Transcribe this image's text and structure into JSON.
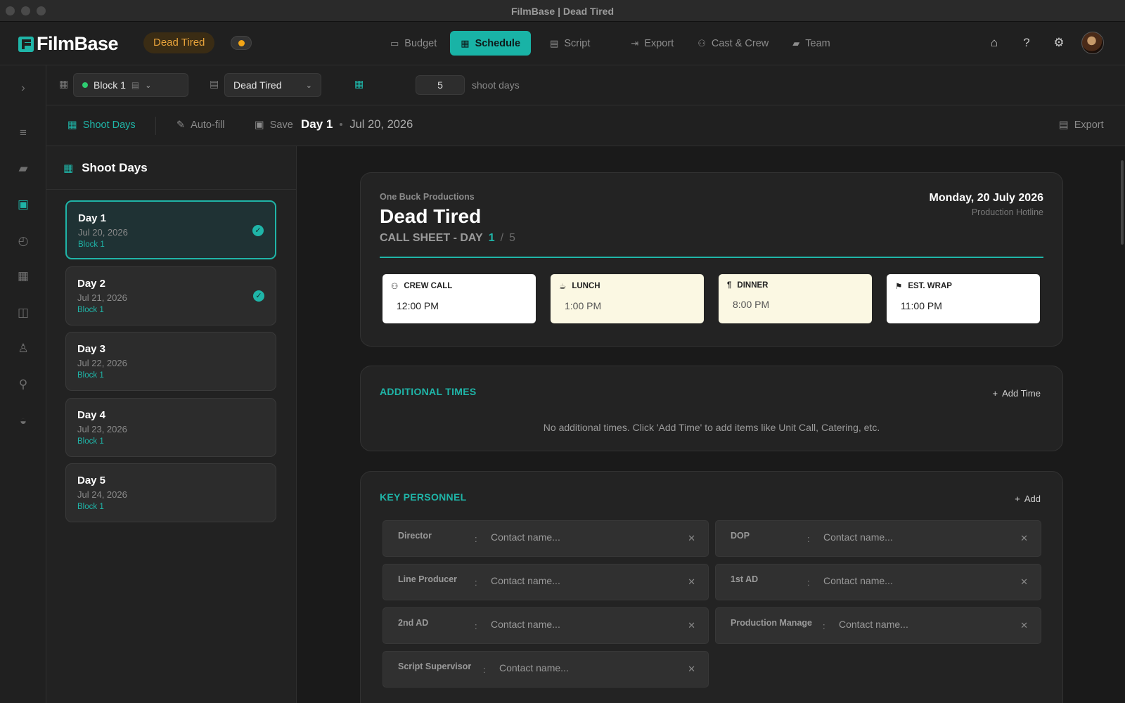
{
  "window": {
    "title": "FilmBase | Dead Tired"
  },
  "app": {
    "logo_text": "FilmBase",
    "project_pill": "Dead Tired",
    "status_color": "#f2a516"
  },
  "nav": {
    "tabs": [
      {
        "label": "Budget",
        "icon": "budget-icon"
      },
      {
        "label": "Schedule",
        "icon": "calendar-icon",
        "active": true
      },
      {
        "label": "Script",
        "icon": "script-icon"
      },
      {
        "label": "Export",
        "icon": "export-icon"
      },
      {
        "label": "Cast & Crew",
        "icon": "people-icon"
      },
      {
        "label": "Team",
        "icon": "chat-icon"
      }
    ]
  },
  "toolbar": {
    "block_select": "Block 1",
    "script_select": "Dead Tired",
    "shoot_days_value": "5",
    "shoot_days_label": "shoot days",
    "shoot_days_btn": "Shoot Days",
    "autofill_btn": "Auto-fill",
    "save_btn": "Save",
    "day_title": "Day 1",
    "day_date": "Jul 20, 2026",
    "export_btn": "Export"
  },
  "sidebar": {
    "title": "Shoot Days",
    "days": [
      {
        "name": "Day 1",
        "date": "Jul 20, 2026",
        "block": "Block 1",
        "done": true,
        "active": true
      },
      {
        "name": "Day 2",
        "date": "Jul 21, 2026",
        "block": "Block 1",
        "done": true
      },
      {
        "name": "Day 3",
        "date": "Jul 22, 2026",
        "block": "Block 1"
      },
      {
        "name": "Day 4",
        "date": "Jul 23, 2026",
        "block": "Block 1"
      },
      {
        "name": "Day 5",
        "date": "Jul 24, 2026",
        "block": "Block 1"
      }
    ]
  },
  "callsheet": {
    "company": "One Buck Productions",
    "title": "Dead Tired",
    "subtitle": "CALL SHEET - DAY",
    "day_current": "1",
    "day_sep": "/",
    "day_total": "5",
    "date_long": "Monday, 20 July 2026",
    "hotline": "Production Hotline",
    "times": [
      {
        "label": "CREW CALL",
        "value": "12:00 PM",
        "icon": "people-icon"
      },
      {
        "label": "LUNCH",
        "value": "1:00 PM",
        "icon": "coffee-icon"
      },
      {
        "label": "DINNER",
        "value": "8:00 PM",
        "icon": "utensils-icon"
      },
      {
        "label": "EST. WRAP",
        "value": "11:00 PM",
        "icon": "flag-icon"
      }
    ]
  },
  "additional_times": {
    "title": "ADDITIONAL TIMES",
    "add_label": "Add Time",
    "empty_text": "No additional times. Click 'Add Time' to add items like Unit Call, Catering, etc."
  },
  "key_personnel": {
    "title": "KEY PERSONNEL",
    "add_label": "Add",
    "placeholder": "Contact name...",
    "roles": [
      "Director",
      "DOP",
      "Line Producer",
      "1st AD",
      "2nd AD",
      "Production Manage",
      "Script Supervisor"
    ]
  }
}
